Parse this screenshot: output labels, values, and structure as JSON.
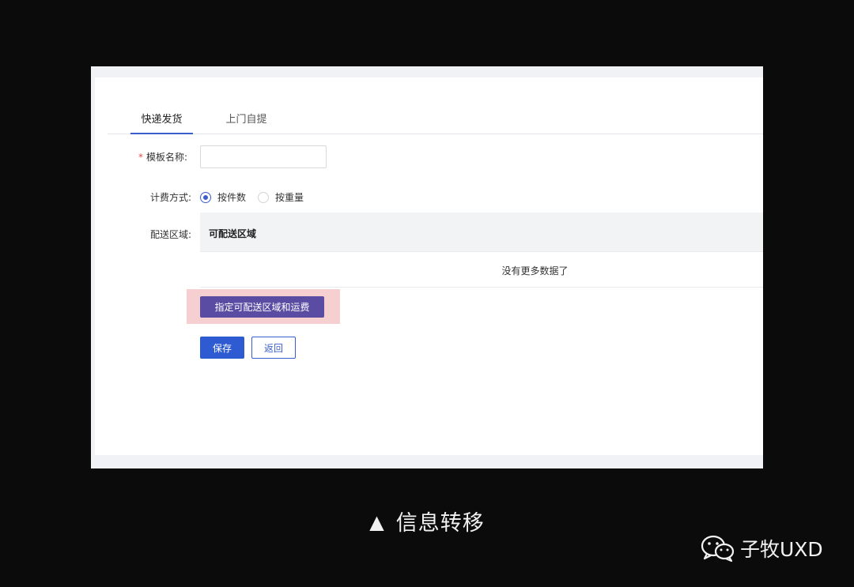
{
  "tabs": [
    {
      "label": "快递发货",
      "active": true
    },
    {
      "label": "上门自提",
      "active": false
    }
  ],
  "form": {
    "name_label": "模板名称:",
    "name_required_mark": "*",
    "name_value": "",
    "fee_label": "计费方式:",
    "fee_options": [
      {
        "label": "按件数",
        "checked": true
      },
      {
        "label": "按重量",
        "checked": false
      }
    ],
    "area_label": "配送区域:",
    "area_table_header": "可配送区域",
    "area_empty_text": "没有更多数据了",
    "assign_button": "指定可配送区域和运费",
    "save_button": "保存",
    "back_button": "返回"
  },
  "caption": {
    "triangle": "▲",
    "text": "信息转移"
  },
  "brand": {
    "icon": "wechat-icon",
    "name": "子牧UXD"
  },
  "colors": {
    "accent": "#3a5fcd",
    "primary_button": "#2f5bd2",
    "assign_button": "#5b4ca3",
    "highlight": "#f6cfd0",
    "background": "#0b0b0b"
  }
}
